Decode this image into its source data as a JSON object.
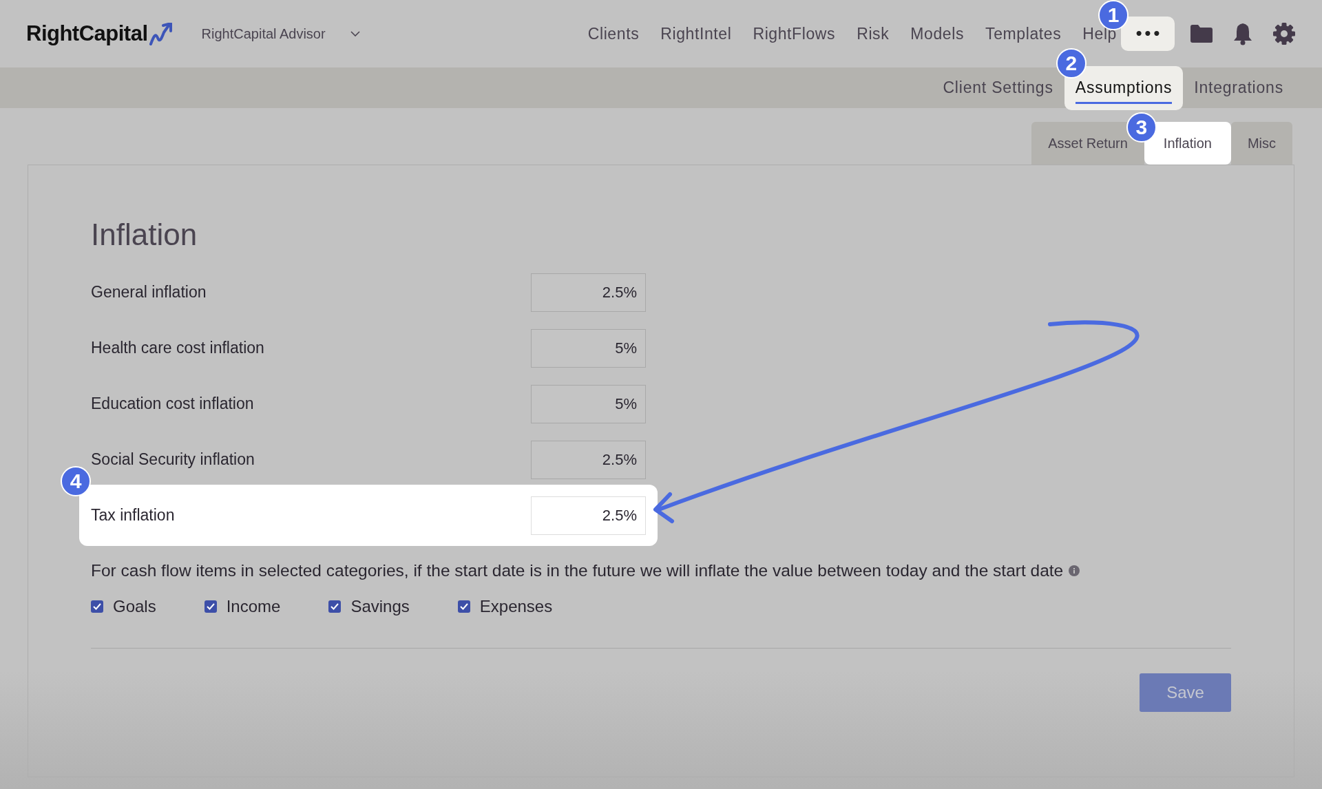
{
  "header": {
    "logo": "RightCapital",
    "account": "RightCapital Advisor",
    "nav": [
      {
        "label": "Clients"
      },
      {
        "label": "RightIntel"
      },
      {
        "label": "RightFlows"
      },
      {
        "label": "Risk"
      },
      {
        "label": "Models"
      },
      {
        "label": "Templates"
      },
      {
        "label": "Help"
      }
    ],
    "more_button": {
      "label": "•••",
      "highlighted": true,
      "badge": "1"
    }
  },
  "settings_tabs": [
    {
      "label": "Client Settings",
      "selected": false
    },
    {
      "label": "Assumptions",
      "selected": true,
      "badge": "2"
    },
    {
      "label": "Integrations",
      "selected": false
    }
  ],
  "sub_tabs": [
    {
      "label": "Asset Return",
      "selected": false
    },
    {
      "label": "Inflation",
      "selected": true,
      "badge": "3"
    },
    {
      "label": "Misc",
      "selected": false
    }
  ],
  "panel": {
    "title": "Inflation",
    "rows": [
      {
        "label": "General inflation",
        "value": "2.5%",
        "highlighted": false
      },
      {
        "label": "Health care cost inflation",
        "value": "5%",
        "highlighted": false
      },
      {
        "label": "Education cost inflation",
        "value": "5%",
        "highlighted": false
      },
      {
        "label": "Social Security inflation",
        "value": "2.5%",
        "highlighted": false
      },
      {
        "label": "Tax inflation",
        "value": "2.5%",
        "highlighted": true,
        "badge": "4"
      }
    ],
    "note": "For cash flow items in selected categories, if the start date is in the future we will inflate the value between today and the start date",
    "categories": [
      {
        "label": "Goals",
        "checked": true
      },
      {
        "label": "Income",
        "checked": true
      },
      {
        "label": "Savings",
        "checked": true
      },
      {
        "label": "Expenses",
        "checked": true
      }
    ],
    "save_button": "Save"
  }
}
